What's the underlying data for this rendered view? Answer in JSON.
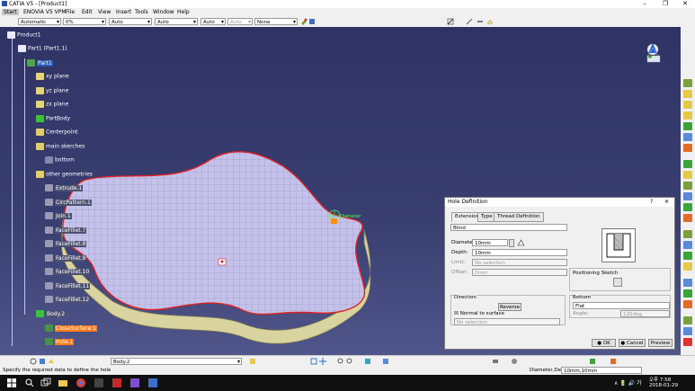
{
  "window": {
    "title": "CATIA V5 - [Product1]",
    "minimize": "–",
    "maximize": "❐",
    "close": "✕"
  },
  "menu": [
    "Start",
    "ENOVIA V5 VPM",
    "File",
    "Edit",
    "View",
    "Insert",
    "Tools",
    "Window",
    "Help"
  ],
  "toolbar": {
    "dropdowns": [
      "Automatic",
      "0%",
      "Auto",
      "Auto",
      "Auto",
      "Auto",
      "None"
    ]
  },
  "tree": [
    {
      "label": "Product1",
      "level": 0,
      "style": "plain",
      "icon": "product-icon"
    },
    {
      "label": "Part1 (Part1.1)",
      "level": 1,
      "style": "plain",
      "icon": "part-instance-icon"
    },
    {
      "label": "Part1",
      "level": 2,
      "style": "hl",
      "icon": "part-icon"
    },
    {
      "label": "xy plane",
      "level": 3,
      "style": "plain",
      "icon": "plane-icon"
    },
    {
      "label": "yz plane",
      "level": 3,
      "style": "plain",
      "icon": "plane-icon"
    },
    {
      "label": "zx plane",
      "level": 3,
      "style": "plain",
      "icon": "plane-icon"
    },
    {
      "label": "PartBody",
      "level": 3,
      "style": "plain",
      "icon": "body-icon"
    },
    {
      "label": "Centerpoint",
      "level": 3,
      "style": "plain",
      "icon": "geoset-icon"
    },
    {
      "label": "main skerches",
      "level": 3,
      "style": "plain",
      "icon": "geoset-icon"
    },
    {
      "label": "bottom",
      "level": 4,
      "style": "plain",
      "icon": "sketch-icon"
    },
    {
      "label": "other geometries",
      "level": 3,
      "style": "plain",
      "icon": "geoset-icon"
    },
    {
      "label": "Extrude.1",
      "level": 4,
      "style": "hlg",
      "icon": "extrude-icon"
    },
    {
      "label": "CircPattern.1",
      "level": 4,
      "style": "hlg",
      "icon": "pattern-icon"
    },
    {
      "label": "Join.1",
      "level": 4,
      "style": "hlg",
      "icon": "join-icon"
    },
    {
      "label": "FaceFillet.7",
      "level": 4,
      "style": "hlg",
      "icon": "fillet-icon"
    },
    {
      "label": "FaceFillet.8",
      "level": 4,
      "style": "hlg",
      "icon": "fillet-icon"
    },
    {
      "label": "FaceFillet.9",
      "level": 4,
      "style": "hlg",
      "icon": "fillet-icon"
    },
    {
      "label": "FaceFillet.10",
      "level": 4,
      "style": "hlg",
      "icon": "fillet-icon"
    },
    {
      "label": "FaceFillet.11",
      "level": 4,
      "style": "hlg",
      "icon": "fillet-icon"
    },
    {
      "label": "FaceFillet.12",
      "level": 4,
      "style": "hlg",
      "icon": "fillet-icon"
    },
    {
      "label": "Body.2",
      "level": 3,
      "style": "hlg",
      "icon": "body-icon"
    },
    {
      "label": "CloseSurface.1",
      "level": 4,
      "style": "hlo",
      "icon": "closesurface-icon"
    },
    {
      "label": "Hole.1",
      "level": 4,
      "style": "hlo",
      "icon": "hole-icon"
    }
  ],
  "hole_dialog": {
    "title": "Hole Definition",
    "help": "?",
    "close": "✕",
    "tabs": [
      "Extension",
      "Type",
      "Thread Definition"
    ],
    "extension_type": "Blind",
    "diameter_label": "Diameter:",
    "diameter_value": "10mm",
    "depth_label": "Depth:",
    "depth_value": "10mm",
    "limit_label": "Limit:",
    "limit_value": "No selection",
    "offset_label": "Offset:",
    "offset_value": "0mm",
    "positioning_sketch_label": "Positioning Sketch",
    "direction_group": "Direction",
    "reverse_button": "Reverse",
    "normal_to_surface": "Normal to surface",
    "direction_selection": "No selection",
    "bottom_group": "Bottom",
    "bottom_type": "Flat",
    "angle_label": "Angle:",
    "angle_value": "120deg",
    "ok": "OK",
    "cancel": "Cancel",
    "preview": "Preview"
  },
  "viewport": {
    "annotation": "Diameter"
  },
  "bottom_toolbar": {
    "body_dropdown": "Body.2"
  },
  "status": {
    "message": "Specify the required data to define the hole",
    "right_label": "Diameter,Depth",
    "right_value": "10mm,10mm"
  },
  "taskbar": {
    "lang": "오후 7:58",
    "date": "2018-01-29",
    "tray": "∧ 🔋 🔊 가"
  },
  "colors": {
    "background": "#2f3364",
    "highlight": "#2c5bb7",
    "orange": "#ff7b1a",
    "part_face": "#c9c6ec",
    "part_side": "#e0dca8",
    "edge": "#e02020"
  }
}
